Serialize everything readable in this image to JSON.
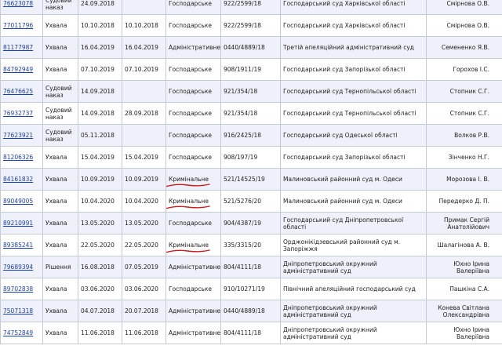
{
  "colors": {
    "link": "#1a3fb5",
    "row_alt": "#eef1f9",
    "grid": "#c4cad6",
    "annotation": "#d0171c"
  },
  "rows": [
    {
      "id": "76623078",
      "kind": "Судовий наказ",
      "date1": "24.09.2018",
      "date2": "",
      "form": "Господарське",
      "case": "922/2599/18",
      "court": "Господарський суд Харківської області",
      "judge": "Смірнова О.В.",
      "underline": false
    },
    {
      "id": "77011796",
      "kind": "Ухвала",
      "date1": "10.10.2018",
      "date2": "10.10.2018",
      "form": "Господарське",
      "case": "922/2599/18",
      "court": "Господарський суд Харківської області",
      "judge": "Смірнова О.В.",
      "underline": false
    },
    {
      "id": "81177987",
      "kind": "Ухвала",
      "date1": "16.04.2019",
      "date2": "16.04.2019",
      "form": "Адміністративне",
      "case": "0440/4889/18",
      "court": "Третій апеляційний адміністративний суд",
      "judge": "Семененко Я.В.",
      "underline": false
    },
    {
      "id": "84792949",
      "kind": "Ухвала",
      "date1": "07.10.2019",
      "date2": "07.10.2019",
      "form": "Господарське",
      "case": "908/1911/19",
      "court": "Господарський суд Запорізької області",
      "judge": "Горохов І.С.",
      "underline": false
    },
    {
      "id": "76476625",
      "kind": "Судовий наказ",
      "date1": "14.09.2018",
      "date2": "",
      "form": "Господарське",
      "case": "921/354/18",
      "court": "Господарський суд Тернопільської області",
      "judge": "Стопник С.Г.",
      "underline": false
    },
    {
      "id": "76932737",
      "kind": "Судовий наказ",
      "date1": "14.09.2018",
      "date2": "28.09.2018",
      "form": "Господарське",
      "case": "921/354/18",
      "court": "Господарський суд Тернопільської області",
      "judge": "Стопник С.Г.",
      "underline": false
    },
    {
      "id": "77623921",
      "kind": "Судовий наказ",
      "date1": "05.11.2018",
      "date2": "",
      "form": "Господарське",
      "case": "916/2425/18",
      "court": "Господарський суд Одеської області",
      "judge": "Волков Р.В.",
      "underline": false
    },
    {
      "id": "81206326",
      "kind": "Ухвала",
      "date1": "15.04.2019",
      "date2": "15.04.2019",
      "form": "Господарське",
      "case": "908/197/19",
      "court": "Господарський суд Запорізької області",
      "judge": "Зінченко Н.Г.",
      "underline": false
    },
    {
      "id": "84161832",
      "kind": "Ухвала",
      "date1": "10.09.2019",
      "date2": "10.09.2019",
      "form": "Кримінальне",
      "case": "521/14525/19",
      "court": "Малиновський районний суд м. Одеси",
      "judge": "Морозова І. В.",
      "underline": true
    },
    {
      "id": "89049005",
      "kind": "Ухвала",
      "date1": "10.04.2020",
      "date2": "10.04.2020",
      "form": "Кримінальне",
      "case": "521/5276/20",
      "court": "Малиновський районний суд м. Одеси",
      "judge": "Передерко Д. П.",
      "underline": true
    },
    {
      "id": "89210991",
      "kind": "Ухвала",
      "date1": "13.05.2020",
      "date2": "13.05.2020",
      "form": "Господарське",
      "case": "904/4387/19",
      "court": "Господарський суд Дніпропетровської області",
      "judge": "Примак Сергій Анатолійович",
      "underline": false
    },
    {
      "id": "89385241",
      "kind": "Ухвала",
      "date1": "22.05.2020",
      "date2": "22.05.2020",
      "form": "Кримінальне",
      "case": "335/3315/20",
      "court": "Орджонікідзевський районний суд м. Запоріжжя",
      "judge": "Шалагінова А. В.",
      "underline": true
    },
    {
      "id": "79689394",
      "kind": "Рішення",
      "date1": "16.08.2018",
      "date2": "07.05.2019",
      "form": "Адміністративне",
      "case": "804/4111/18",
      "court": "Дніпропетровський окружний адміністративний суд",
      "judge": "Юхно Ірина Валеріївна",
      "underline": false
    },
    {
      "id": "89702838",
      "kind": "Ухвала",
      "date1": "03.06.2020",
      "date2": "03.06.2020",
      "form": "Господарське",
      "case": "910/10271/19",
      "court": "Північний апеляційний господарський суд",
      "judge": "Пашкіна С.А.",
      "underline": false
    },
    {
      "id": "75071318",
      "kind": "Ухвала",
      "date1": "04.07.2018",
      "date2": "20.07.2018",
      "form": "Адміністративне",
      "case": "0440/4889/18",
      "court": "Дніпропетровський окружний адміністративний суд",
      "judge": "Конева Світлана Олександрівна",
      "underline": false
    },
    {
      "id": "74752849",
      "kind": "Ухвала",
      "date1": "11.06.2018",
      "date2": "11.06.2018",
      "form": "Адміністративне",
      "case": "804/4111/18",
      "court": "Дніпропетровський окружний адміністративний суд",
      "judge": "Юхно Ірина Валеріївна",
      "underline": false
    }
  ]
}
